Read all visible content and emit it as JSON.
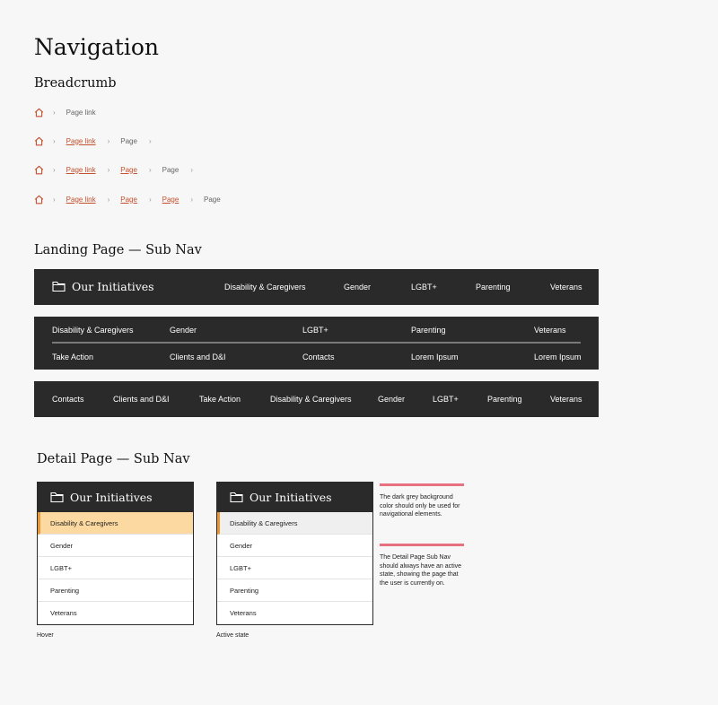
{
  "page_title": "Navigation",
  "breadcrumb_section": {
    "heading": "Breadcrumb",
    "rows": [
      {
        "items": [
          {
            "label": "Page link",
            "type": "current"
          }
        ]
      },
      {
        "items": [
          {
            "label": "Page link",
            "type": "link"
          },
          {
            "label": "Page",
            "type": "current"
          }
        ],
        "trailing_chevron": true
      },
      {
        "items": [
          {
            "label": "Page link",
            "type": "link"
          },
          {
            "label": "Page",
            "type": "link"
          },
          {
            "label": "Page",
            "type": "current"
          }
        ],
        "trailing_chevron": true
      },
      {
        "items": [
          {
            "label": "Page link",
            "type": "link"
          },
          {
            "label": "Page",
            "type": "link"
          },
          {
            "label": "Page",
            "type": "link"
          },
          {
            "label": "Page",
            "type": "current"
          }
        ]
      }
    ]
  },
  "landing": {
    "heading": "Landing Page — Sub Nav",
    "bar1": {
      "title": "Our Initiatives",
      "items": [
        "Disability & Caregivers",
        "Gender",
        "LGBT+",
        "Parenting",
        "Veterans"
      ]
    },
    "bar2": {
      "row1": [
        "Disability & Caregivers",
        "Gender",
        "LGBT+",
        "Parenting",
        "Veterans"
      ],
      "row2": [
        "Take Action",
        "Clients and  D&I",
        "Contacts",
        "Lorem Ipsum",
        "Lorem Ipsum"
      ]
    },
    "bar3": {
      "items": [
        "Contacts",
        "Clients and  D&I",
        "Take Action",
        "Disability & Caregivers",
        "Gender",
        "LGBT+",
        "Parenting",
        "Veterans"
      ]
    }
  },
  "detail": {
    "heading": "Detail Page — Sub Nav",
    "cards": [
      {
        "title": "Our Initiatives",
        "caption": "Hover",
        "highlight": "hover",
        "items": [
          "Disability & Caregivers",
          "Gender",
          "LGBT+",
          "Parenting",
          "Veterans"
        ]
      },
      {
        "title": "Our Initiatives",
        "caption": "Active state",
        "highlight": "active",
        "items": [
          "Disability & Caregivers",
          "Gender",
          "LGBT+",
          "Parenting",
          "Veterans"
        ]
      }
    ],
    "notes": [
      "The dark grey background color should only be used for navigational elements.",
      "The Detail Page Sub Nav should always have an active state, showing the page that the user is currently on."
    ]
  },
  "colors": {
    "nav_bg": "#2a2a2a",
    "link": "#c4502d",
    "hover_bg": "#fcd9a0",
    "accent_border": "#e8973a",
    "active_bg": "#efefef",
    "note_rule": "#e66f80"
  },
  "icons": {
    "home": "home-icon",
    "chevron": "chevron-right-icon",
    "folder": "folder-icon"
  }
}
